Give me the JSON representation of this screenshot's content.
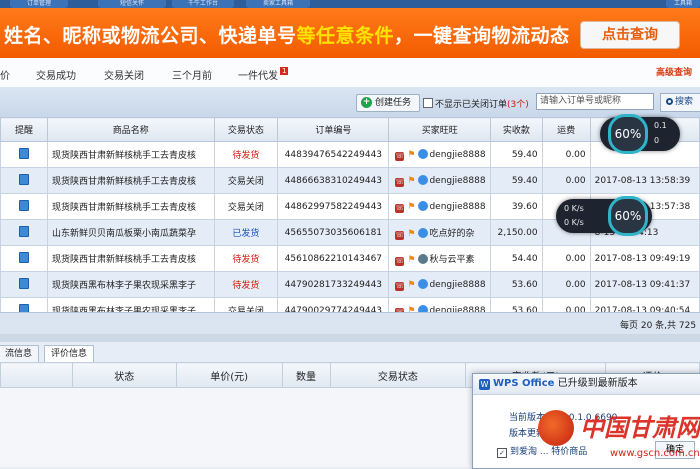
{
  "top_nav": {
    "tabs": [
      "订单管理",
      "短信关怀",
      "千牛工作台",
      "卖家工具箱",
      "工具箱"
    ]
  },
  "banner": {
    "text_part1": "姓名、昵称或物流公司、快递单号",
    "text_highlight": "等任意条件",
    "text_part2": "，一键查询物流动态",
    "query_button": "点击查询"
  },
  "filter_tabs": {
    "items": [
      "价",
      "交易成功",
      "交易关闭",
      "三个月前",
      "一件代发"
    ],
    "badge": "1",
    "advanced_search": "高级查询"
  },
  "toolbar": {
    "create_task": "创建任务",
    "hide_closed_label": "不显示已关闭订单",
    "hide_closed_count": "(3个)",
    "search_placeholder": "请输入订单号或昵称",
    "search_button": "搜索"
  },
  "table": {
    "headers": [
      "提醒",
      "商品名称",
      "交易状态",
      "订单编号",
      "买家旺旺",
      "实收款",
      "运费",
      "创建时间"
    ],
    "rows": [
      {
        "name": "现货陕西甘肃新鲜核桃手工去青皮核",
        "status": "待发货",
        "status_color": "red",
        "order_id": "44839476542249443",
        "buyer": "dengjie8888",
        "amount": "59.40",
        "shipping": "0.00",
        "time": ""
      },
      {
        "name": "现货陕西甘肃新鲜核桃手工去青皮核",
        "status": "交易关闭",
        "status_color": "dark",
        "order_id": "44866638310249443",
        "buyer": "dengjie8888",
        "amount": "59.40",
        "shipping": "0.00",
        "time": "2017-08-13 13:58:39"
      },
      {
        "name": "现货陕西甘肃新鲜核桃手工去青皮核",
        "status": "交易关闭",
        "status_color": "dark",
        "order_id": "44862997582249443",
        "buyer": "dengjie8888",
        "amount": "39.60",
        "shipping": "0.00",
        "time": "2017-08-13 13:57:38"
      },
      {
        "name": "山东新鲜贝贝南瓜板栗小南瓜蔬菜孕",
        "status": "已发货",
        "status_color": "blue",
        "order_id": "45655073035606181",
        "buyer": "吃点好的杂",
        "amount": "2,150.00",
        "shipping": "",
        "time": "8-13 12:34:13"
      },
      {
        "name": "现货陕西甘肃新鲜核桃手工去青皮核",
        "status": "待发货",
        "status_color": "red",
        "order_id": "45610862210143467",
        "buyer": "秋与云平素",
        "amount": "54.40",
        "shipping": "0.00",
        "time": "2017-08-13 09:49:19"
      },
      {
        "name": "现货陕西黑布林李子果农现采黑李子",
        "status": "待发货",
        "status_color": "red",
        "order_id": "44790281733249443",
        "buyer": "dengjie8888",
        "amount": "53.60",
        "shipping": "0.00",
        "time": "2017-08-13 09:41:37"
      },
      {
        "name": "现货陕西黑布林李子果农现采黑李子",
        "status": "交易关闭",
        "status_color": "dark",
        "order_id": "44790029774249443",
        "buyer": "dengjie8888",
        "amount": "53.60",
        "shipping": "0.00",
        "time": "2017-08-13 09:40:54"
      }
    ]
  },
  "pager": {
    "text": "每页 20 条,共 725"
  },
  "lower_tabs": [
    "流信息",
    "评价信息"
  ],
  "lower_table": {
    "headers": [
      "",
      "状态",
      "单价(元)",
      "数量",
      "交易状态",
      "实收款(元)",
      "评价"
    ]
  },
  "net_monitor": {
    "top": {
      "percent": "60%",
      "up": "0.1",
      "down": "0"
    },
    "mid": {
      "percent": "60%",
      "up": "0 K/s",
      "down": "0 K/s"
    }
  },
  "wps_popup": {
    "brand": "WPS Office",
    "title": "已升级到最新版本",
    "version_line": "当前版本号：10.1.0.6690",
    "date_line": "版本更新日期：",
    "checkbox_label": "到爱淘 ... 特价商品",
    "ok_button": "确定"
  },
  "watermark": {
    "text": "中国甘肃网",
    "url": "www.gscn.com.cn"
  }
}
